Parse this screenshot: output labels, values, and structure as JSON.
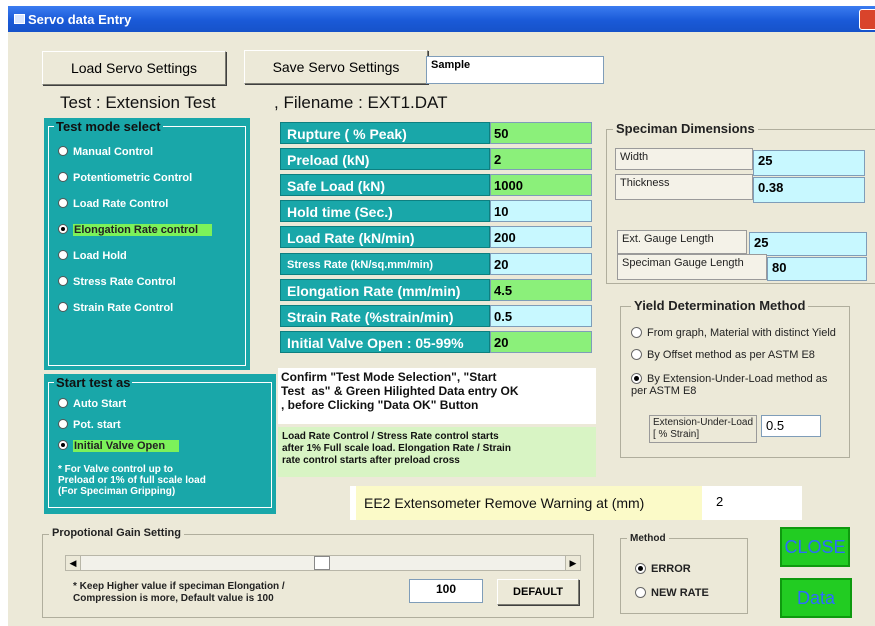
{
  "window": {
    "title": "Servo data Entry"
  },
  "toolbar": {
    "load_label": "Load Servo Settings",
    "save_label": "Save  Servo Settings",
    "name_value": "Sample"
  },
  "header": {
    "test_text": "Test : Extension Test",
    "filename_text": ",  Filename : EXT1.DAT"
  },
  "test_mode": {
    "title": "Test mode select",
    "options": [
      "Manual Control",
      "Potentiometric Control",
      "Load Rate Control",
      "Elongation Rate control",
      "Load Hold",
      "Stress Rate Control",
      "Strain Rate Control"
    ],
    "selected_index": 3
  },
  "params": [
    {
      "label": "Rupture ( % Peak)",
      "value": "50"
    },
    {
      "label": "Preload (kN)",
      "value": "2"
    },
    {
      "label": "Safe Load (kN)",
      "value": "1000"
    },
    {
      "label": "Hold time (Sec.)",
      "value": "10"
    },
    {
      "label": "Load Rate (kN/min)",
      "value": "200"
    },
    {
      "label": "Stress Rate (kN/sq.mm/min)",
      "value": "20"
    },
    {
      "label": "Elongation Rate (mm/min)",
      "value": "4.5"
    },
    {
      "label": "Strain Rate (%strain/min)",
      "value": "0.5"
    },
    {
      "label": "Initial Valve Open : 05-99%",
      "value": "20"
    }
  ],
  "specimen": {
    "title": "Speciman Dimensions",
    "width_label": "Width",
    "width_value": "25",
    "thickness_label": "Thickness",
    "thickness_value": "0.38",
    "ext_label": "Ext. Gauge Length",
    "ext_value": "25",
    "spec_label": "Speciman Gauge Length",
    "spec_value": "80"
  },
  "yield": {
    "title": "Yield Determination Method",
    "options": [
      "From graph, Material with distinct Yield",
      "By Offset method as per ASTM E8",
      "By Extension-Under-Load method as per ASTM E8"
    ],
    "selected_index": 2,
    "ext_label": "Extension-Under-Load\n[ % Strain]",
    "ext_value": "0.5"
  },
  "start": {
    "title": "Start test as",
    "options": [
      "Auto Start",
      "Pot. start",
      "Initial Valve Open"
    ],
    "selected_index": 2,
    "note": "* For Valve control up to\nPreload or 1% of full scale load\n(For Speciman Gripping)"
  },
  "messages": {
    "confirm": "Confirm \"Test Mode Selection\", \"Start\nTest  as\" & Green Hilighted Data entry OK\n, before Clicking \"Data OK\" Button",
    "load_rate_note": "Load Rate Control / Stress Rate control starts\nafter 1% Full scale load. Elongation Rate / Strain\nrate control starts after preload cross"
  },
  "extensometer": {
    "label": "EE2 Extensometer Remove Warning at (mm)",
    "value": "2"
  },
  "gain": {
    "title": "Propotional Gain Setting",
    "note": "* Keep Higher value if speciman Elongation /\nCompression is more, Default value is 100",
    "value": "100",
    "default_label": "DEFAULT",
    "slider_fraction": 0.5
  },
  "method": {
    "title": "Method",
    "options": [
      "ERROR",
      "NEW RATE"
    ],
    "selected_index": 0
  },
  "buttons": {
    "close_label": "CLOSE",
    "ok_label": "Data OK"
  },
  "colors": {
    "teal": "#19a7a9",
    "green_highlight": "#8bf07a",
    "cyan_entry": "#c8f8ff",
    "button_green": "#22cc22"
  }
}
